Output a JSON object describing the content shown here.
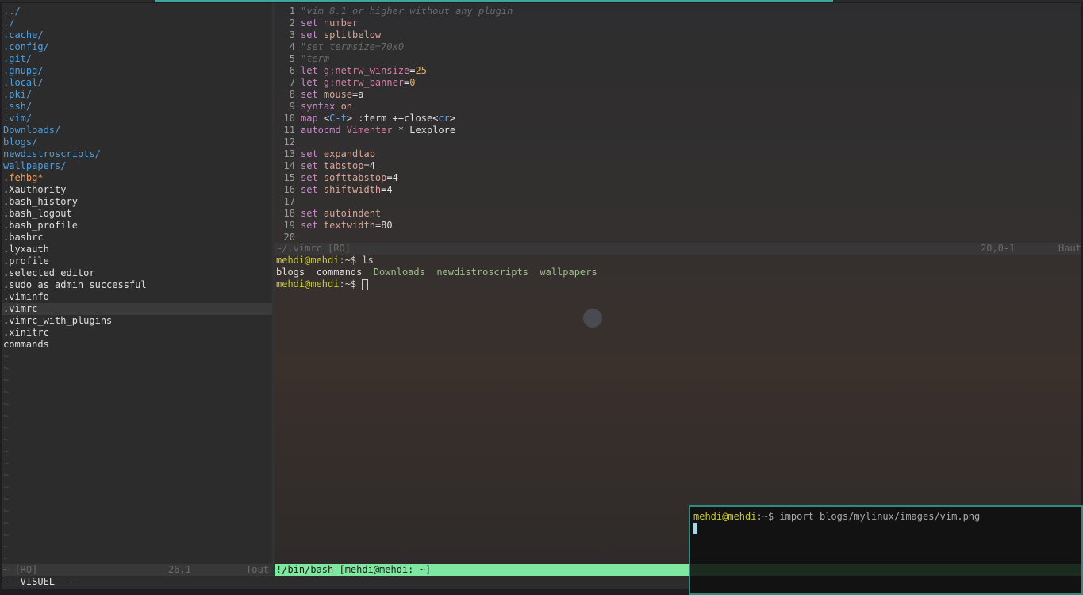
{
  "netrw": {
    "entries": [
      {
        "t": "dir",
        "n": "../"
      },
      {
        "t": "dir",
        "n": "./"
      },
      {
        "t": "dir",
        "n": ".cache/"
      },
      {
        "t": "dir",
        "n": ".config/"
      },
      {
        "t": "dir",
        "n": ".git/"
      },
      {
        "t": "dir",
        "n": ".gnupg/"
      },
      {
        "t": "dir",
        "n": ".local/"
      },
      {
        "t": "dir",
        "n": ".pki/"
      },
      {
        "t": "dir",
        "n": ".ssh/"
      },
      {
        "t": "dir",
        "n": ".vim/"
      },
      {
        "t": "dir",
        "n": "Downloads/"
      },
      {
        "t": "dir",
        "n": "blogs/"
      },
      {
        "t": "dir",
        "n": "newdistroscripts/"
      },
      {
        "t": "dir",
        "n": "wallpapers/"
      },
      {
        "t": "exe",
        "n": ".fehbg*"
      },
      {
        "t": "file",
        "n": ".Xauthority"
      },
      {
        "t": "file",
        "n": ".bash_history"
      },
      {
        "t": "file",
        "n": ".bash_logout"
      },
      {
        "t": "file",
        "n": ".bash_profile"
      },
      {
        "t": "file",
        "n": ".bashrc"
      },
      {
        "t": "file",
        "n": ".lyxauth"
      },
      {
        "t": "file",
        "n": ".profile"
      },
      {
        "t": "file",
        "n": ".selected_editor"
      },
      {
        "t": "file",
        "n": ".sudo_as_admin_successful"
      },
      {
        "t": "file",
        "n": ".viminfo"
      },
      {
        "t": "file",
        "n": ".vimrc",
        "cur": true
      },
      {
        "t": "file",
        "n": ".vimrc_with_plugins"
      },
      {
        "t": "file",
        "n": ".xinitrc"
      },
      {
        "t": "file",
        "n": "commands"
      }
    ],
    "status": {
      "name": "~ [RO]",
      "pos": "26,1",
      "pct": "Tout"
    }
  },
  "vimrc": {
    "lines": [
      [
        [
          "cm",
          "\"vim 8.1 or higher without any plugin"
        ]
      ],
      [
        [
          "kw",
          "set "
        ],
        [
          "op",
          "number"
        ]
      ],
      [
        [
          "kw",
          "set "
        ],
        [
          "op",
          "splitbelow"
        ]
      ],
      [
        [
          "cm",
          "\"set termsize=70x0"
        ]
      ],
      [
        [
          "cm",
          "\"term"
        ]
      ],
      [
        [
          "kw",
          "let "
        ],
        [
          "var",
          "g:netrw_winsize"
        ],
        [
          "file",
          "="
        ],
        [
          "val",
          "25"
        ]
      ],
      [
        [
          "kw",
          "let "
        ],
        [
          "var",
          "g:netrw_banner"
        ],
        [
          "file",
          "="
        ],
        [
          "val",
          "0"
        ]
      ],
      [
        [
          "kw",
          "set "
        ],
        [
          "op",
          "mouse"
        ],
        [
          "file",
          "=a"
        ]
      ],
      [
        [
          "kw",
          "syntax "
        ],
        [
          "op",
          "on"
        ]
      ],
      [
        [
          "kw",
          "map "
        ],
        [
          "file",
          "<"
        ],
        [
          "bl",
          "C-t"
        ],
        [
          "file",
          "> :term ++close<"
        ],
        [
          "bl",
          "cr"
        ],
        [
          "file",
          ">"
        ]
      ],
      [
        [
          "kw",
          "autocmd "
        ],
        [
          "var",
          "Vimenter"
        ],
        [
          "file",
          " * Lexplore"
        ]
      ],
      [],
      [
        [
          "kw",
          "set "
        ],
        [
          "op",
          "expandtab"
        ]
      ],
      [
        [
          "kw",
          "set "
        ],
        [
          "op",
          "tabstop"
        ],
        [
          "file",
          "=4"
        ]
      ],
      [
        [
          "kw",
          "set "
        ],
        [
          "op",
          "softtabstop"
        ],
        [
          "file",
          "=4"
        ]
      ],
      [
        [
          "kw",
          "set "
        ],
        [
          "op",
          "shiftwidth"
        ],
        [
          "file",
          "=4"
        ]
      ],
      [],
      [
        [
          "kw",
          "set "
        ],
        [
          "op",
          "autoindent"
        ]
      ],
      [
        [
          "kw",
          "set "
        ],
        [
          "op",
          "textwidth"
        ],
        [
          "file",
          "=80"
        ]
      ],
      []
    ],
    "status": {
      "name": "~/.vimrc [RO]",
      "pos": "20,0-1",
      "pct": "Haut"
    }
  },
  "terminal": {
    "prompt_user": "mehdi@mehdi",
    "prompt_rest": ":~$ ",
    "cmd1": "ls",
    "ls_output": [
      "blogs",
      "commands",
      "Downloads",
      "newdistroscripts",
      "wallpapers"
    ],
    "status": "!/bin/bash [mehdi@mehdi: ~]"
  },
  "cmdline": "-- VISUEL --",
  "popup": {
    "prompt_user": "mehdi@mehdi",
    "prompt_rest": ":~$ ",
    "command": "import blogs/mylinux/images/vim.png"
  }
}
